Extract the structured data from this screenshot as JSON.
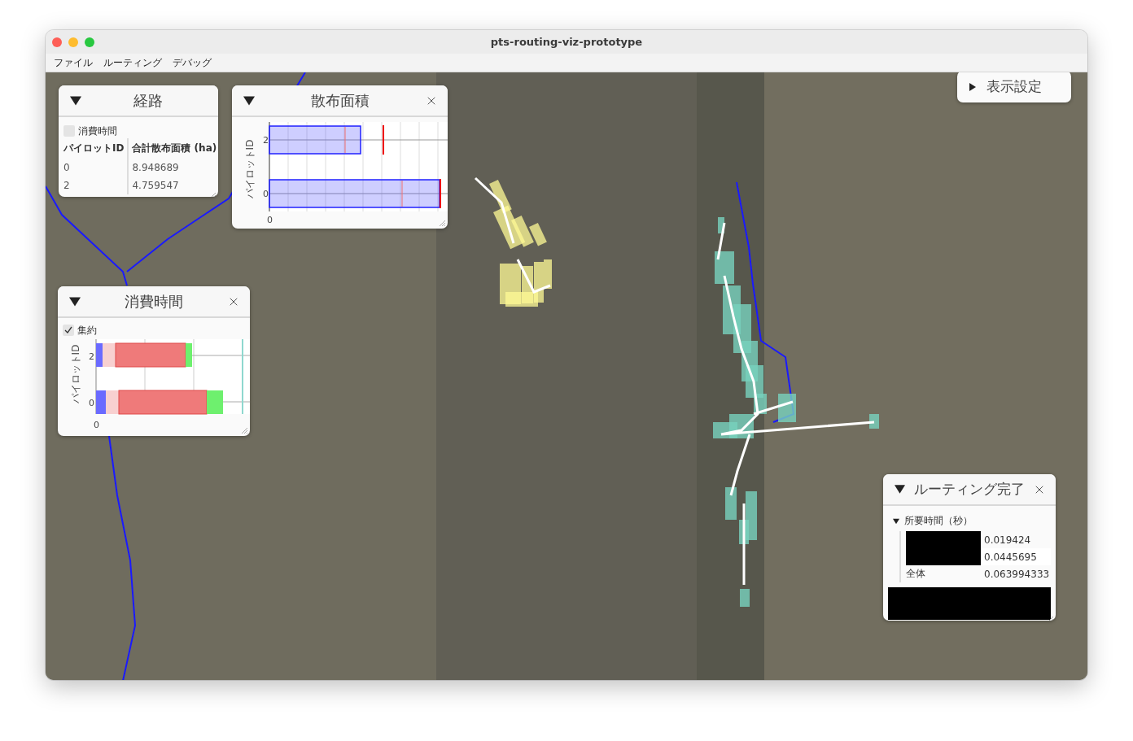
{
  "window": {
    "title": "pts-routing-viz-prototype"
  },
  "menu": [
    "ファイル",
    "ルーティング",
    "デバッグ"
  ],
  "settings_button": {
    "label": "表示設定",
    "expanded": false
  },
  "panels": [
    {
      "kind": "table",
      "title": "経路",
      "expanded": true,
      "closable": false,
      "checkbox": {
        "label": "消費時間",
        "checked": false
      },
      "columns": [
        "パイロットID",
        "合計散布面積 (ha)"
      ],
      "rows": [
        [
          "0",
          "8.948689"
        ],
        [
          "2",
          "4.759547"
        ]
      ]
    },
    {
      "kind": "area_chart",
      "title": "散布面積",
      "expanded": true,
      "closable": true,
      "ylabel": "パイロットID",
      "y_ticks": [
        "2",
        "0"
      ],
      "x_ticks": [
        "0"
      ]
    },
    {
      "kind": "time_chart",
      "title": "消費時間",
      "expanded": true,
      "closable": true,
      "checkbox": {
        "label": "集約",
        "checked": true
      },
      "ylabel": "パイロットID",
      "y_ticks": [
        "2",
        "0"
      ],
      "x_ticks": [
        "0"
      ]
    },
    {
      "kind": "tree",
      "title": "ルーティング完了",
      "expanded": true,
      "closable": true,
      "node": {
        "label": "所要時間（秒）",
        "expanded": true,
        "rows": [
          {
            "redacted": true,
            "value": "0.019424",
            "selected": false
          },
          {
            "redacted": true,
            "value": "0.0445695",
            "selected": true
          },
          {
            "redacted": false,
            "label": "全体",
            "value": "0.063994333",
            "selected": false
          }
        ]
      },
      "footer_redacted": true
    }
  ]
}
